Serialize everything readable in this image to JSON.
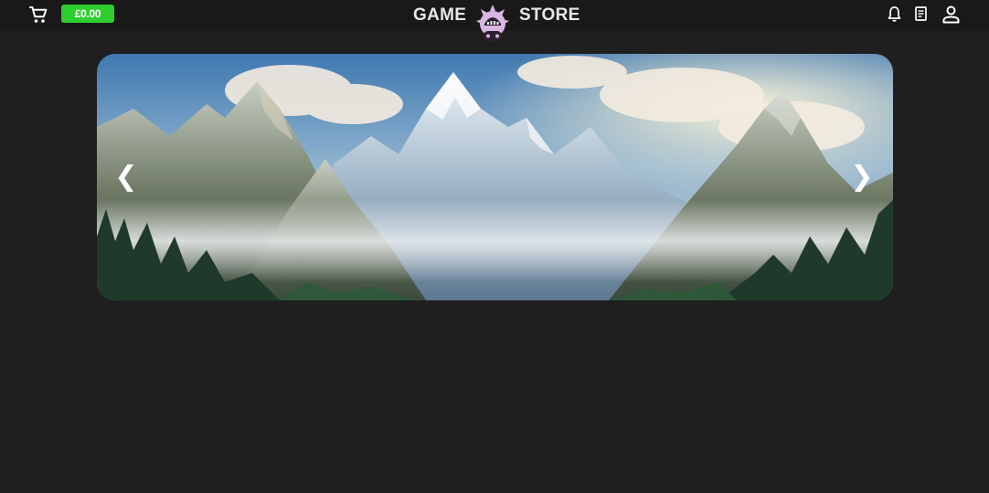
{
  "header": {
    "balance": "£0.00",
    "brand_left": "GAME",
    "brand_right": "STORE",
    "icons": [
      "cart-icon",
      "bell-icon",
      "receipt-icon",
      "user-icon"
    ]
  },
  "carousel": {
    "prev_glyph": "❮",
    "next_glyph": "❯",
    "slide_image": "mountain-landscape-slide"
  },
  "colors": {
    "background": "#1f1f1f",
    "topbar": "#191919",
    "balance_badge": "#2fce2f",
    "brand_text": "#e7e7e7",
    "logo_accent": "#d9b6e3"
  }
}
